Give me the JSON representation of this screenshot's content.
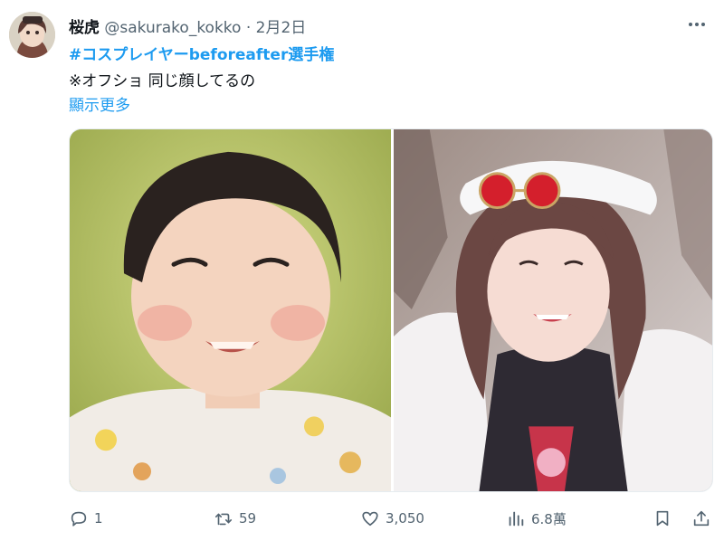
{
  "post": {
    "display_name": "桜虎",
    "handle": "@sakurako_kokko",
    "separator": "·",
    "date": "2月2日",
    "hashtag": "#コスプレイヤーbeforeafter選手権",
    "text": "※オフショ 同じ顔してるの",
    "show_more": "顯示更多"
  },
  "actions": {
    "replies": "1",
    "reposts": "59",
    "likes": "3,050",
    "views": "6.8萬"
  },
  "icons": {
    "reply": "reply-icon",
    "repost": "repost-icon",
    "like": "heart-icon",
    "views": "views-icon",
    "bookmark": "bookmark-icon",
    "share": "share-icon",
    "more": "more-icon"
  },
  "colors": {
    "link": "#1d9bf0",
    "secondary_text": "#536471",
    "primary_text": "#0f1419"
  }
}
